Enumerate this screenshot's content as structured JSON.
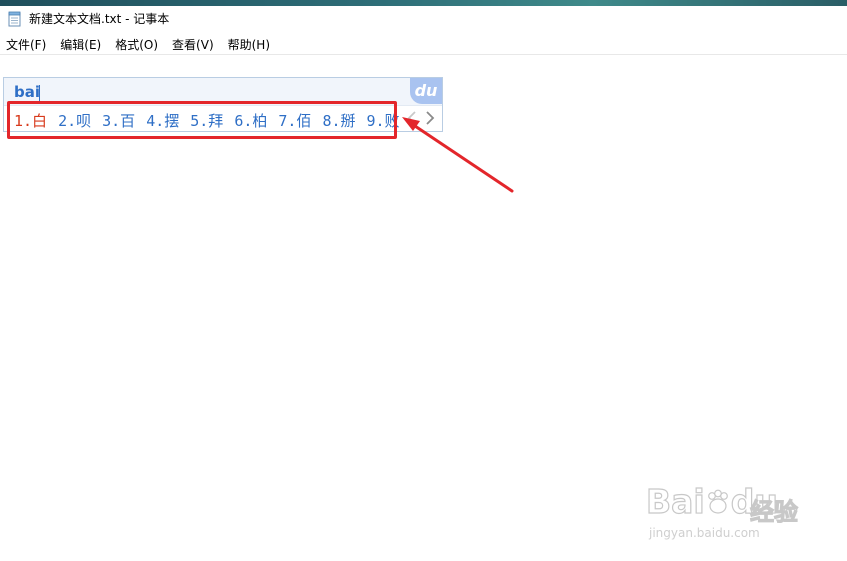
{
  "window": {
    "title": "新建文本文档.txt - 记事本"
  },
  "menu": [
    {
      "label": "文件(F)",
      "name": "menu-file"
    },
    {
      "label": "编辑(E)",
      "name": "menu-edit"
    },
    {
      "label": "格式(O)",
      "name": "menu-format"
    },
    {
      "label": "查看(V)",
      "name": "menu-view"
    },
    {
      "label": "帮助(H)",
      "name": "menu-help"
    }
  ],
  "ime": {
    "pinyin": "bai",
    "logo_text": "du",
    "candidates": [
      "1.白",
      "2.呗",
      "3.百",
      "4.摆",
      "5.拜",
      "6.柏",
      "7.佰",
      "8.掰",
      "9.败"
    ],
    "selected_index": 0,
    "prev_icon": "chevron-left-icon",
    "next_icon": "chevron-right-icon"
  },
  "watermark": {
    "main": "Bai",
    "main_suffix": "du",
    "cn": "经验",
    "url": "jingyan.baidu.com"
  },
  "colors": {
    "candidate": "#2f6fc6",
    "candidate_selected": "#d83a1c",
    "annotation": "#e3262b"
  }
}
